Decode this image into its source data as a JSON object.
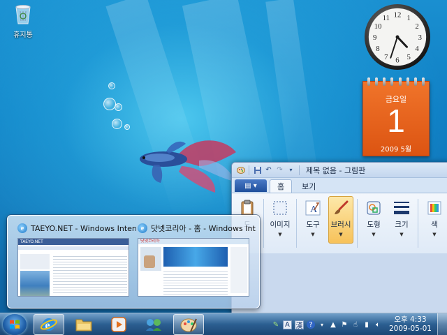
{
  "desktop": {
    "recycle_bin_label": "휴지통"
  },
  "calendar_gadget": {
    "weekday": "금요일",
    "day": "1",
    "month_year": "2009 5월"
  },
  "clock_gadget": {
    "hours": 4,
    "minutes": 33,
    "numerals": [
      "12",
      "1",
      "2",
      "3",
      "4",
      "5",
      "6",
      "7",
      "8",
      "9",
      "10",
      "11"
    ]
  },
  "paint": {
    "title": "제목 없음 - 그림판",
    "tabs": [
      {
        "label": "홈",
        "active": true
      },
      {
        "label": "보기",
        "active": false
      }
    ],
    "ribbon": [
      {
        "label": "드",
        "icon": "clipboard-icon",
        "dropdown": false,
        "active": false
      },
      {
        "label": "이미지",
        "icon": "select-icon",
        "dropdown": true,
        "active": false
      },
      {
        "label": "도구",
        "icon": "text-tool-icon",
        "dropdown": true,
        "active": false
      },
      {
        "label": "브러시",
        "icon": "brush-icon",
        "dropdown": true,
        "active": true
      },
      {
        "label": "도형",
        "icon": "shapes-icon",
        "dropdown": true,
        "active": false
      },
      {
        "label": "크기",
        "icon": "line-size-icon",
        "dropdown": true,
        "active": false
      },
      {
        "label": "색",
        "icon": "color-palette-icon",
        "dropdown": true,
        "active": false
      }
    ]
  },
  "thumbnails": [
    {
      "title": "TAEYO.NET - Windows Internet...",
      "site": "TAEYO.NET"
    },
    {
      "title": "닷넷코리아 - 홈 - Windows Int...",
      "site": "닷넷코리아"
    }
  ],
  "taskbar": {
    "pinned": [
      "internet-explorer",
      "windows-explorer",
      "media-player",
      "network-app",
      "paint"
    ],
    "tray": {
      "ime_a": "A",
      "ime_han": "漢",
      "time": "오후 4:33",
      "date": "2009-05-01"
    }
  },
  "colors": {
    "calendar_orange": "#dc5412",
    "taskbar_blue": "#2d5f91",
    "ribbon_active": "#f7c25a"
  }
}
